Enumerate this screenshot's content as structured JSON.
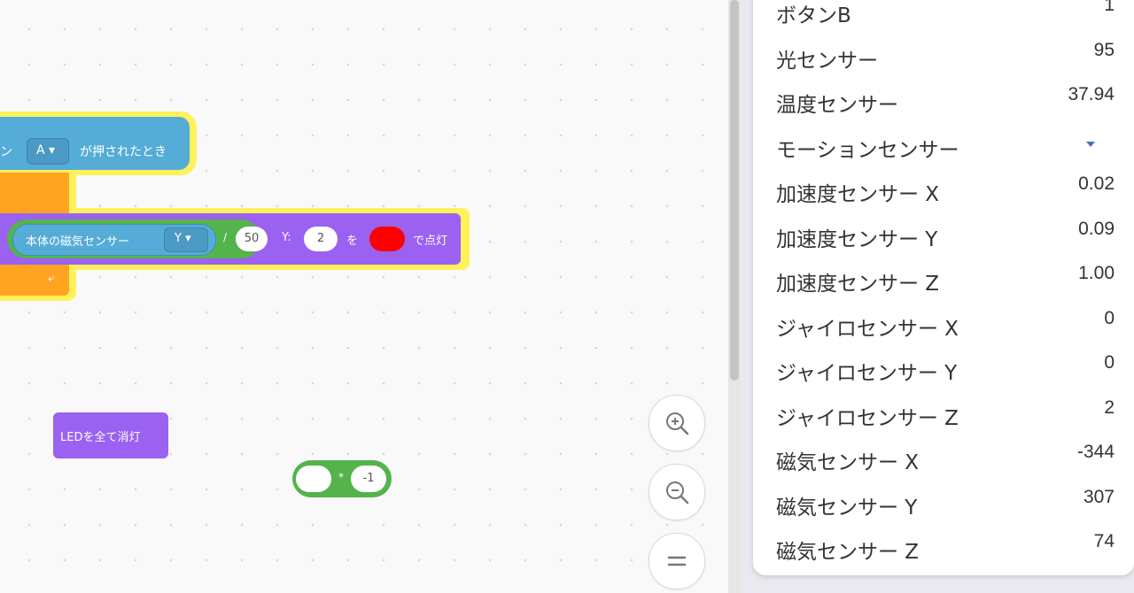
{
  "workspace": {
    "hat_block": {
      "text": "ン",
      "dropdown": "A ▾",
      "text2": "が押されたとき"
    },
    "led_block": {
      "sensor_text": "本体の磁気センサー",
      "sensor_dropdown": "Y ▾",
      "operator": "/",
      "divisor": "50",
      "y_label": "Y:",
      "y_value": "2",
      "wo_label": "を",
      "color": "#ff0000",
      "suffix": "で点灯"
    },
    "loop_arrow": "⤶",
    "clear_block": {
      "text": "LEDを全て消灯"
    },
    "math_block": {
      "left": "",
      "operator": "*",
      "right": "-1"
    }
  },
  "zoom": {
    "zoom_in_icon": "zoom-in-icon",
    "zoom_out_icon": "zoom-out-icon",
    "reset_icon": "zoom-reset-icon"
  },
  "sensors": [
    {
      "name": "ボタンB",
      "value": "1"
    },
    {
      "name": "光センサー",
      "value": "95"
    },
    {
      "name": "温度センサー",
      "value": "37.94"
    },
    {
      "name": "モーションセンサー",
      "value": ""
    },
    {
      "name": "加速度センサー X",
      "value": "0.02"
    },
    {
      "name": "加速度センサー Y",
      "value": "0.09"
    },
    {
      "name": "加速度センサー Z",
      "value": "1.00"
    },
    {
      "name": "ジャイロセンサー X",
      "value": "0"
    },
    {
      "name": "ジャイロセンサー Y",
      "value": "0"
    },
    {
      "name": "ジャイロセンサー Z",
      "value": "2"
    },
    {
      "name": "磁気センサー X",
      "value": "-344"
    },
    {
      "name": "磁気センサー Y",
      "value": "307"
    },
    {
      "name": "磁気センサー Z",
      "value": "74"
    }
  ],
  "colors": {
    "event_block": "#55acd6",
    "control_block": "#ffa321",
    "display_block": "#9b61f0",
    "operator_block": "#55b34c",
    "highlight": "#fff15a"
  }
}
